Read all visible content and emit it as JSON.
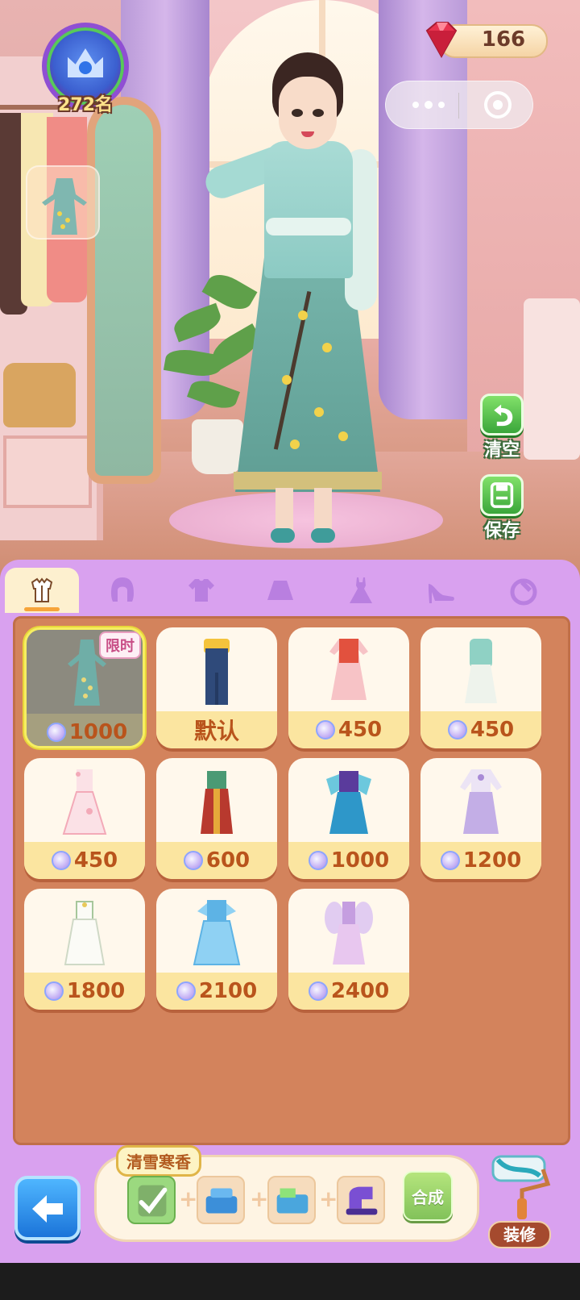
{
  "hud": {
    "rank_label": "272名",
    "gem_count": "166",
    "menu_icon": "more-dots-icon",
    "close_icon": "target-circle-icon"
  },
  "side_buttons": {
    "clear_label": "清空",
    "save_label": "保存"
  },
  "tabs": [
    {
      "name": "outfit",
      "icon": "outfit-icon",
      "active": true
    },
    {
      "name": "hair",
      "icon": "hair-icon",
      "active": false
    },
    {
      "name": "top",
      "icon": "tshirt-icon",
      "active": false
    },
    {
      "name": "skirt",
      "icon": "skirt-icon",
      "active": false
    },
    {
      "name": "dress",
      "icon": "dress-icon",
      "active": false
    },
    {
      "name": "shoes",
      "icon": "high-heel-icon",
      "active": false
    },
    {
      "name": "accessory",
      "icon": "accessory-icon",
      "active": false
    }
  ],
  "items": [
    {
      "price": "1000",
      "badge": "限时",
      "selected": true,
      "palette": [
        "#6faea7",
        "#e9d77a"
      ]
    },
    {
      "price": "默认",
      "badge": "",
      "selected": false,
      "palette": [
        "#2f4a7a",
        "#f4c33c"
      ]
    },
    {
      "price": "450",
      "badge": "",
      "selected": false,
      "palette": [
        "#f7c3c6",
        "#e2513e"
      ]
    },
    {
      "price": "450",
      "badge": "",
      "selected": false,
      "palette": [
        "#eef3ec",
        "#8fd1c4"
      ]
    },
    {
      "price": "450",
      "badge": "",
      "selected": false,
      "palette": [
        "#fbe1e6",
        "#f3aab8"
      ]
    },
    {
      "price": "600",
      "badge": "",
      "selected": false,
      "palette": [
        "#b8392e",
        "#4a9a74"
      ]
    },
    {
      "price": "1000",
      "badge": "",
      "selected": false,
      "palette": [
        "#2e97c9",
        "#5a3b9c"
      ]
    },
    {
      "price": "1200",
      "badge": "",
      "selected": false,
      "palette": [
        "#ece4f5",
        "#a88ad6"
      ]
    },
    {
      "price": "1800",
      "badge": "",
      "selected": false,
      "palette": [
        "#fbfbf6",
        "#a7c79b"
      ]
    },
    {
      "price": "2100",
      "badge": "",
      "selected": false,
      "palette": [
        "#8fd1f3",
        "#5db3e5"
      ]
    },
    {
      "price": "2400",
      "badge": "",
      "selected": false,
      "palette": [
        "#e8c7ef",
        "#c59ee0"
      ]
    }
  ],
  "combine": {
    "set_name": "清雪寒香",
    "button_label": "合成",
    "slots": [
      {
        "icon": "owned-outfit-icon",
        "owned": true
      },
      {
        "icon": "sewing-box-icon",
        "owned": false
      },
      {
        "icon": "fabric-box-icon",
        "owned": false
      },
      {
        "icon": "sewing-machine-icon",
        "owned": false
      }
    ]
  },
  "bottom": {
    "decorate_label": "装修"
  },
  "colors": {
    "panel": "#d9a1ef",
    "grid": "#d3835c",
    "accent_green": "#3aa63a",
    "price_text": "#b9541c"
  }
}
